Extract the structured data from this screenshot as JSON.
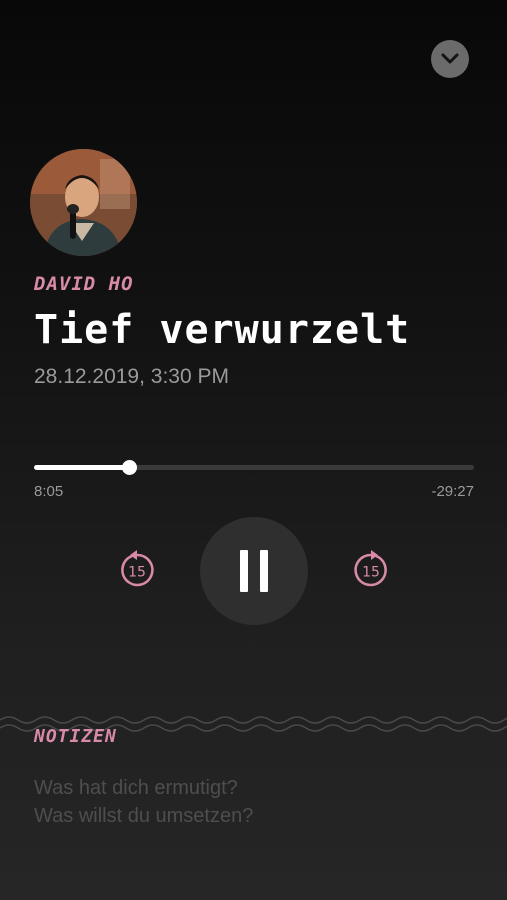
{
  "header": {
    "collapse_icon": "chevron-down-icon"
  },
  "episode": {
    "avatar_icon": "speaker-photo",
    "author": "DAVID HO",
    "title": "Tief verwurzelt",
    "date": "28.12.2019, 3:30 PM"
  },
  "player": {
    "progress_fraction": 0.215,
    "elapsed": "8:05",
    "remaining": "-29:27",
    "skip_back_label": "15",
    "skip_forward_label": "15",
    "skip_back_icon": "rewind-15-icon",
    "skip_forward_icon": "forward-15-icon",
    "play_state_icon": "pause-icon"
  },
  "notes": {
    "label": "NOTIZEN",
    "placeholder": "Was hat dich ermutigt?\nWas willst du umsetzen?"
  },
  "colors": {
    "accent": "#d88aa8",
    "background": "#121212",
    "button": "#2f2f2f"
  }
}
